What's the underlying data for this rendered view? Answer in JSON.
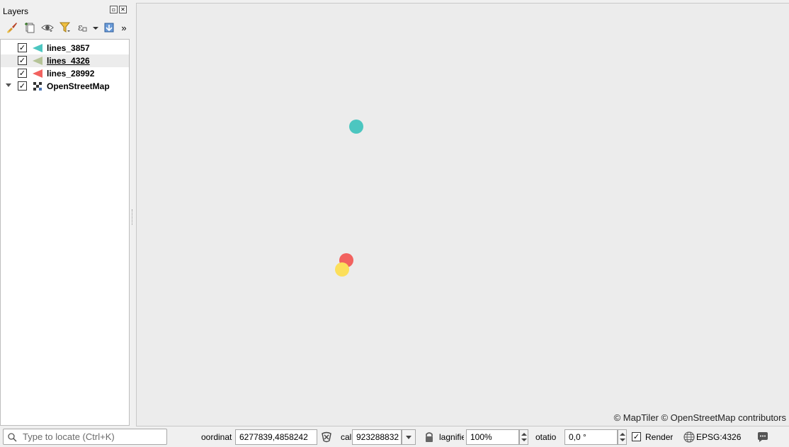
{
  "layers_panel": {
    "title": "Layers",
    "float_button": "▫",
    "close_button": "✕",
    "more_tools": "»",
    "layers": [
      {
        "name": "lines_3857",
        "checked": true,
        "symbol_color": "#4cc6c0",
        "selected": false,
        "expandable": false
      },
      {
        "name": "lines_4326",
        "checked": true,
        "symbol_color": "#b5c397",
        "selected": true,
        "expandable": false
      },
      {
        "name": "lines_28992",
        "checked": true,
        "symbol_color": "#f2625f",
        "selected": false,
        "expandable": false
      },
      {
        "name": "OpenStreetMap",
        "checked": true,
        "symbol_color": "#333333",
        "selected": false,
        "expandable": true
      }
    ]
  },
  "map": {
    "background": "#ececec",
    "points": [
      {
        "color": "#4cc6c0"
      },
      {
        "color": "#f2625f"
      },
      {
        "color": "#fcdf5b"
      }
    ],
    "attribution": "© MapTiler  © OpenStreetMap contributors"
  },
  "status_bar": {
    "locator_placeholder": "Type to locate (Ctrl+K)",
    "coordinate_label": "oordinat",
    "coordinate_value": "6277839,4858242",
    "scale_label": "cal",
    "scale_value": "923288832",
    "magnifier_label": "lagnifie",
    "magnifier_value": "100%",
    "rotation_label": "otatio",
    "rotation_value": "0,0 °",
    "render_label": "Render",
    "render_checked": true,
    "crs": "EPSG:4326"
  },
  "check_mark": "✓"
}
